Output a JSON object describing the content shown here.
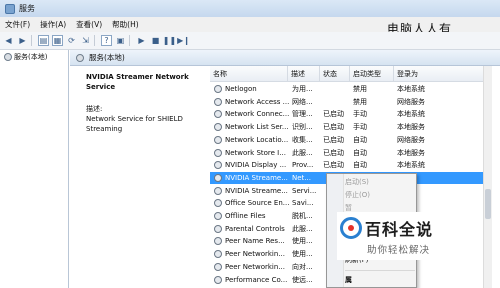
{
  "window": {
    "title": "服务"
  },
  "watermark_top": "电脑人人有",
  "menu": [
    "文件(F)",
    "操作(A)",
    "查看(V)",
    "帮助(H)"
  ],
  "tree": {
    "root_label": "服务(本地)"
  },
  "pane": {
    "header": "服务(本地)"
  },
  "description": {
    "service_title": "NVIDIA Streamer Network Service",
    "label": "描述:",
    "text": "Network Service for SHIELD Streaming"
  },
  "columns": [
    "名称",
    "描述",
    "状态",
    "启动类型",
    "登录为"
  ],
  "rows": [
    {
      "name": "Netlogon",
      "desc": "为用...",
      "status": "",
      "startup": "禁用",
      "logon": "本地系统"
    },
    {
      "name": "Network Access ...",
      "desc": "网络...",
      "status": "",
      "startup": "禁用",
      "logon": "网络服务"
    },
    {
      "name": "Network Connec...",
      "desc": "管理...",
      "status": "已启动",
      "startup": "手动",
      "logon": "本地系统"
    },
    {
      "name": "Network List Ser...",
      "desc": "识别...",
      "status": "已启动",
      "startup": "手动",
      "logon": "本地服务"
    },
    {
      "name": "Network Locatio...",
      "desc": "收集...",
      "status": "已启动",
      "startup": "自动",
      "logon": "网络服务"
    },
    {
      "name": "Network Store I...",
      "desc": "此服...",
      "status": "已启动",
      "startup": "自动",
      "logon": "本地服务"
    },
    {
      "name": "NVIDIA Display ...",
      "desc": "Prov...",
      "status": "已启动",
      "startup": "自动",
      "logon": "本地系统"
    },
    {
      "name": "NVIDIA Streame...",
      "desc": "Net...",
      "status": "",
      "startup": "",
      "logon": "务"
    },
    {
      "name": "NVIDIA Streame...",
      "desc": "Servi...",
      "status": "",
      "startup": "",
      "logon": ""
    },
    {
      "name": "Office Source En...",
      "desc": "Savi...",
      "status": "",
      "startup": "",
      "logon": ""
    },
    {
      "name": "Offline Files",
      "desc": "脱机...",
      "status": "",
      "startup": "",
      "logon": ""
    },
    {
      "name": "Parental Controls",
      "desc": "此服...",
      "status": "",
      "startup": "",
      "logon": ""
    },
    {
      "name": "Peer Name Res...",
      "desc": "使用...",
      "status": "",
      "startup": "",
      "logon": ""
    },
    {
      "name": "Peer Networkin...",
      "desc": "使用...",
      "status": "",
      "startup": "",
      "logon": ""
    },
    {
      "name": "Peer Networkin...",
      "desc": "向对...",
      "status": "",
      "startup": "",
      "logon": ""
    },
    {
      "name": "Performance Co...",
      "desc": "使远...",
      "status": "",
      "startup": "",
      "logon": ""
    }
  ],
  "context_menu": {
    "start": "启动(S)",
    "stop": "停止(O)",
    "refresh": "刷新(F)",
    "frag1": "暂",
    "frag2": "恢",
    "frag3": "所",
    "frag4": "属"
  },
  "brand": {
    "name": "百科全说",
    "sub": "助你轻松解决"
  },
  "colors": {
    "selection": "#3399ff",
    "title_bar": "#c5d8ee"
  }
}
